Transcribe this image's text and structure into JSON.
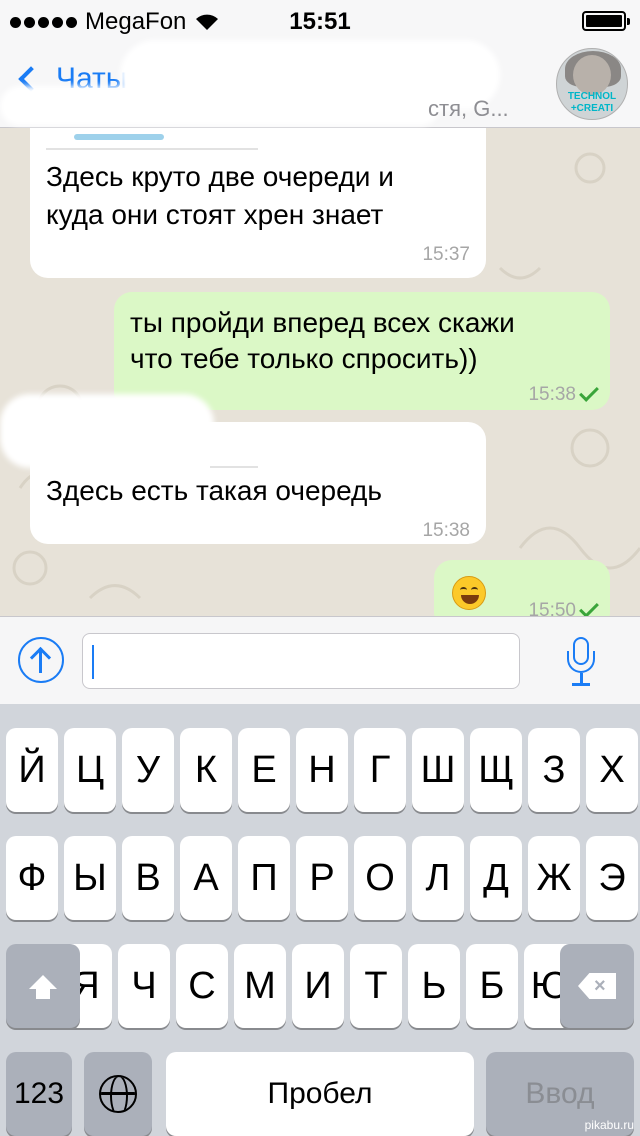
{
  "status_bar": {
    "carrier": "MegaFon",
    "time": "15:51"
  },
  "nav": {
    "back_label": "Чаты",
    "subtitle": "стя, G..."
  },
  "avatar": {
    "line1": "TECHNOL",
    "line2": "+CREATI"
  },
  "messages": [
    {
      "direction": "incoming",
      "lines": [
        "Здесь круто две очереди и",
        "куда они стоят хрен знает"
      ],
      "time": "15:37"
    },
    {
      "direction": "outgoing",
      "lines": [
        "ты пройди вперед всех скажи",
        "что тебе только спросить))"
      ],
      "time": "15:38",
      "read": true
    },
    {
      "direction": "incoming",
      "lines": [
        "Здесь есть такая очередь"
      ],
      "time": "15:38"
    },
    {
      "direction": "outgoing",
      "emoji": "grinning-face",
      "time": "15:50",
      "read": true
    }
  ],
  "input": {
    "value": "",
    "placeholder": ""
  },
  "keyboard": {
    "row1": [
      "Й",
      "Ц",
      "У",
      "К",
      "Е",
      "Н",
      "Г",
      "Ш",
      "Щ",
      "З",
      "Х"
    ],
    "row2": [
      "Ф",
      "Ы",
      "В",
      "А",
      "П",
      "Р",
      "О",
      "Л",
      "Д",
      "Ж",
      "Э"
    ],
    "row3": [
      "Я",
      "Ч",
      "С",
      "М",
      "И",
      "Т",
      "Ь",
      "Б",
      "Ю"
    ],
    "numbers_label": "123",
    "space_label": "Пробел",
    "enter_label": "Ввод"
  },
  "watermark": "pikabu.ru",
  "colors": {
    "accent": "#1a7cf5",
    "outgoing_bubble": "#dbf8c6",
    "incoming_bubble": "#ffffff",
    "read_check": "#3aa53a"
  }
}
